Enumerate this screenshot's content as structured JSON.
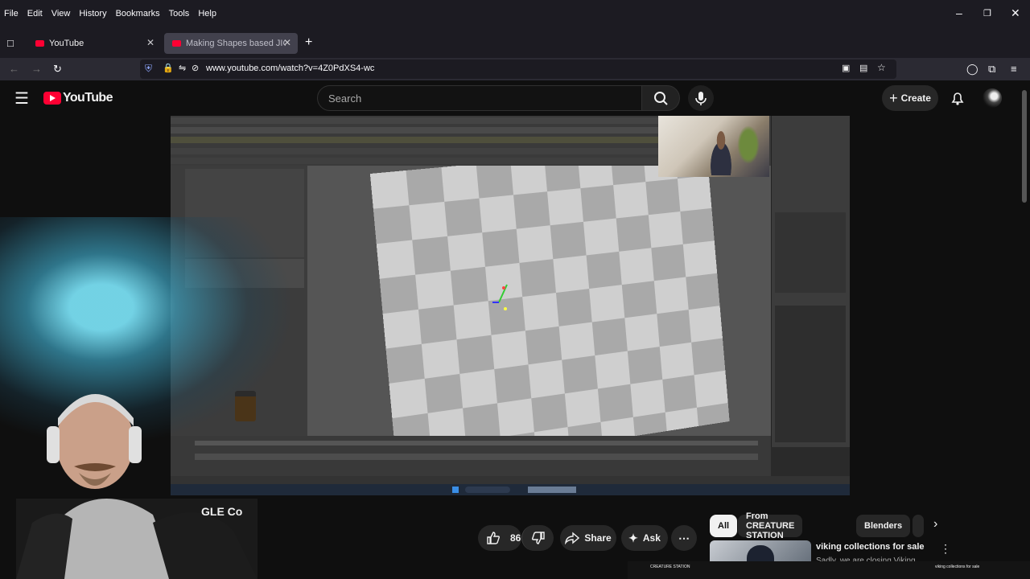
{
  "browser": {
    "menu": [
      "File",
      "Edit",
      "View",
      "History",
      "Bookmarks",
      "Tools",
      "Help"
    ],
    "tabs": [
      {
        "label": "YouTube",
        "active": false
      },
      {
        "label": "Making Shapes based JIGGLE Cl",
        "active": true
      }
    ],
    "url": "www.youtube.com/watch?v=4Z0PdXS4-wc"
  },
  "youtube": {
    "logo_text": "YouTube",
    "search_placeholder": "Search",
    "create_label": "Create"
  },
  "video": {
    "title_fragment": "GLE Co",
    "brand_color": "#ff0033"
  },
  "actions": {
    "like_count": "86",
    "share_label": "Share",
    "ask_label": "Ask"
  },
  "chips": [
    "All",
    "From CREATURE STATION",
    "Blenders"
  ],
  "recommendation": {
    "title": "viking collections for sale",
    "subtitle": "Sadly, we are closing Viking"
  },
  "bottom_strip": {
    "channel": "CREATURE STATION",
    "title": "viking collections for sale"
  }
}
